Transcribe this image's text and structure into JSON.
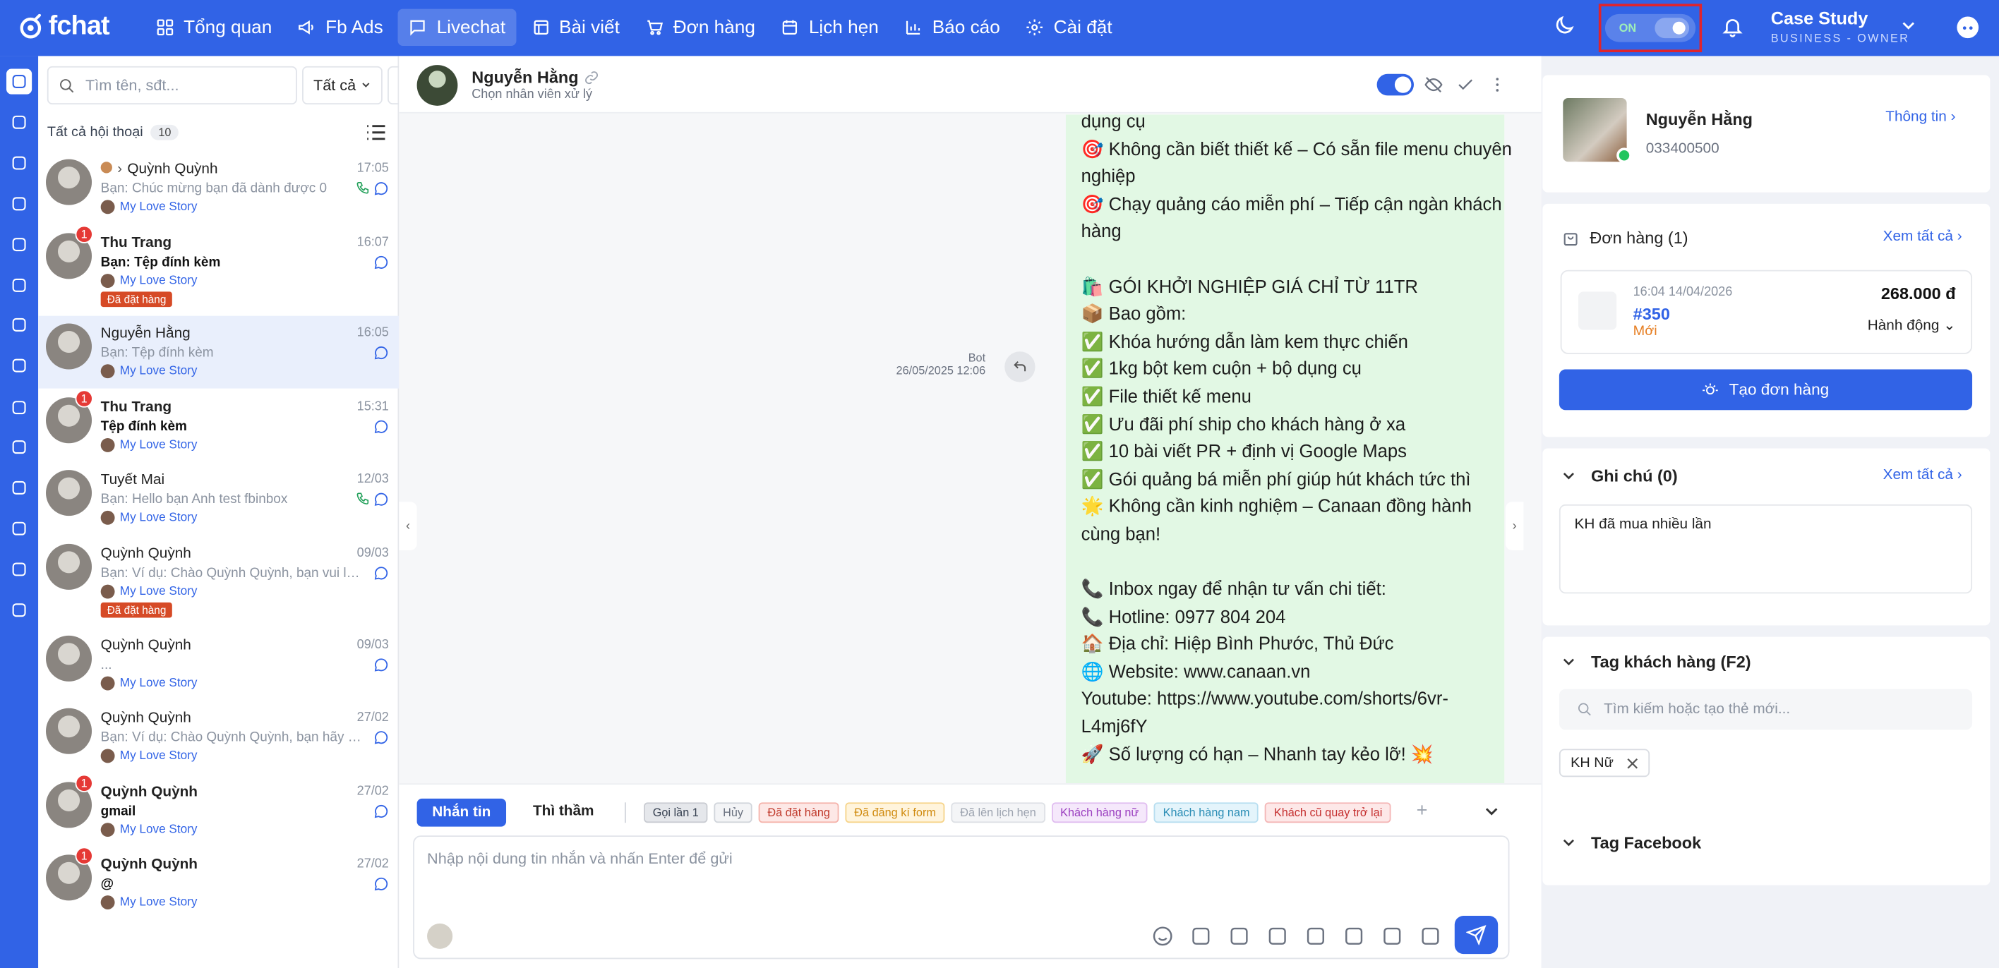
{
  "app": {
    "logo_text": "fchat"
  },
  "nav": [
    {
      "label": "Tổng quan",
      "icon": "grid-icon"
    },
    {
      "label": "Fb Ads",
      "icon": "megaphone-icon"
    },
    {
      "label": "Livechat",
      "icon": "chat-icon",
      "active": true
    },
    {
      "label": "Bài viết",
      "icon": "document-icon"
    },
    {
      "label": "Đơn hàng",
      "icon": "cart-icon"
    },
    {
      "label": "Lịch hẹn",
      "icon": "calendar-icon"
    },
    {
      "label": "Báo cáo",
      "icon": "bar-chart-icon"
    },
    {
      "label": "Cài đặt",
      "icon": "gear-icon"
    }
  ],
  "header": {
    "toggle_label": "ON",
    "toggle_on": true
  },
  "account": {
    "name": "Case Study",
    "role": "BUSINESS - OWNER"
  },
  "colors": {
    "primary": "#3163e6",
    "highlight_border": "#e0242c",
    "bubble": "#e2f8e4",
    "unread": "#e53935",
    "order_tag": "#d64a26"
  },
  "sidebar_icons": [
    "apps-icon",
    "chat-bubble-icon",
    "chats-icon",
    "phone-icon",
    "mail-icon",
    "percent-icon",
    "circle-icon",
    "ad-off-icon",
    "check-circle-icon",
    "users-icon",
    "calendar-icon",
    "robot-icon",
    "megaphone-icon",
    "file-text-icon"
  ],
  "conv_list": {
    "search_placeholder": "Tìm tên, sđt...",
    "filter": "Tất cả",
    "add": "+",
    "all_label": "Tất cả hội thoại",
    "all_count": "10",
    "items": [
      {
        "name": "Quỳnh Quỳnh",
        "msg": "Bạn: Chúc mừng bạn đã dành được 0",
        "page": "My Love Story",
        "time": "17:05",
        "unread": "",
        "tag": "",
        "bold": false,
        "phone": true,
        "prefix": true
      },
      {
        "name": "Thu Trang",
        "msg": "Bạn: Tệp đính kèm",
        "page": "My Love Story",
        "time": "16:07",
        "unread": "1",
        "tag": "Đã đặt hàng",
        "bold": true
      },
      {
        "name": "Nguyễn Hằng",
        "msg": "Bạn: Tệp đính kèm",
        "page": "My Love Story",
        "time": "16:05",
        "unread": "",
        "tag": "",
        "bold": false,
        "active": true
      },
      {
        "name": "Thu Trang",
        "msg": "Tệp đính kèm",
        "page": "My Love Story",
        "time": "15:31",
        "unread": "1",
        "tag": "",
        "bold": true
      },
      {
        "name": "Tuyết Mai",
        "msg": "Bạn: Hello bạn Anh test fbinbox",
        "page": "My Love Story",
        "time": "12/03",
        "unread": "",
        "tag": "",
        "bold": false,
        "phone": true
      },
      {
        "name": "Quỳnh Quỳnh",
        "msg": "Bạn: Ví dụ: Chào Quỳnh Quỳnh, bạn vui lòn...",
        "page": "My Love Story",
        "time": "09/03",
        "unread": "",
        "tag": "Đã đặt hàng",
        "bold": false
      },
      {
        "name": "Quỳnh Quỳnh",
        "msg": "...",
        "page": "My Love Story",
        "time": "09/03",
        "unread": "",
        "tag": "",
        "bold": false
      },
      {
        "name": "Quỳnh Quỳnh",
        "msg": "Bạn: Ví dụ: Chào Quỳnh Quỳnh, bạn hãy kiể...",
        "page": "My Love Story",
        "time": "27/02",
        "unread": "",
        "tag": "",
        "bold": false
      },
      {
        "name": "Quỳnh Quỳnh",
        "msg": "gmail",
        "page": "My Love Story",
        "time": "27/02",
        "unread": "1",
        "tag": "",
        "bold": true
      },
      {
        "name": "Quỳnh Quỳnh",
        "msg": "@",
        "page": "My Love Story",
        "time": "27/02",
        "unread": "1",
        "tag": "",
        "bold": true
      }
    ]
  },
  "chat": {
    "name": "Nguyễn Hằng",
    "sub": "Chọn nhân viên xử lý",
    "bot_label": "Bot",
    "bot_time": "26/05/2025 12:06",
    "lines": [
      "dụng cụ",
      "🎯 Không cần biết thiết kế – Có sẵn file menu chuyên",
      "nghiệp",
      "🎯 Chạy quảng cáo miễn phí – Tiếp cận ngàn khách",
      "hàng",
      "",
      "🛍️ GÓI KHỞI NGHIỆP GIÁ CHỈ TỪ 11TR",
      "📦 Bao gồm:",
      "✅ Khóa hướng dẫn làm kem thực chiến",
      "✅ 1kg bột kem cuộn + bộ dụng cụ",
      "✅ File thiết kế menu",
      "✅ Ưu đãi phí ship cho khách hàng ở xa",
      "✅ 10 bài viết PR + định vị Google Maps",
      "✅ Gói quảng bá miễn phí giúp hút khách tức thì",
      "🌟 Không cần kinh nghiệm – Canaan đồng hành",
      "cùng bạn!",
      "",
      "📞 Inbox ngay để nhận tư vấn chi tiết:",
      "📞 Hotline: 0977 804 204",
      "🏠 Địa chỉ: Hiệp Bình Phước, Thủ Đức",
      "🌐 Website: www.canaan.vn",
      "Youtube: https://www.youtube.com/shorts/6vr-",
      "L4mj6fY",
      "🚀 Số lượng có hạn – Nhanh tay kẻo lỡ! 💥",
      ""
    ],
    "tab_message": "Nhắn tin",
    "tab_whisper": "Thì thầm",
    "quick_tags": [
      {
        "label": "Gọi lần 1",
        "bg": "#e5e7eb",
        "fg": "#374151",
        "bd": "#c9ccd2"
      },
      {
        "label": "Hủy",
        "bg": "#f3f4f6",
        "fg": "#6b7280",
        "bd": "#d1d5db"
      },
      {
        "label": "Đã đặt hàng",
        "bg": "#fde8e6",
        "fg": "#c0392b",
        "bd": "#f5b3ab"
      },
      {
        "label": "Đã đăng kí form",
        "bg": "#fff4dc",
        "fg": "#d08b10",
        "bd": "#f6d48a"
      },
      {
        "label": "Đã lên lịch hẹn",
        "bg": "#f4f5f7",
        "fg": "#9ca3af",
        "bd": "#dde0e5"
      },
      {
        "label": "Khách hàng nữ",
        "bg": "#f5e8fb",
        "fg": "#9b3fc0",
        "bd": "#e0bdf0"
      },
      {
        "label": "Khách hàng nam",
        "bg": "#e4f4fb",
        "fg": "#2a8db5",
        "bd": "#b7def0"
      },
      {
        "label": "Khách cũ quay trở lại",
        "bg": "#fde8e8",
        "fg": "#c53030",
        "bd": "#f4b6b6"
      }
    ],
    "input_placeholder": "Nhập nội dung tin nhắn và nhấn Enter để gửi"
  },
  "customer": {
    "name": "Nguyễn Hằng",
    "phone": "033400500",
    "info_link": "Thông tin",
    "orders_title": "Đơn hàng (1)",
    "view_all": "Xem tất cả",
    "order": {
      "date": "16:04 14/04/2026",
      "id": "#350",
      "status": "Mới",
      "amount": "268.000 đ",
      "action": "Hành động"
    },
    "create_order": "Tạo đơn hàng",
    "notes_title": "Ghi chú (0)",
    "note": "KH đã mua nhiều lần",
    "tags_title": "Tag khách hàng (F2)",
    "tag_search_placeholder": "Tìm kiếm hoặc tạo thẻ mới...",
    "tag": "KH Nữ",
    "fb_tags_title": "Tag Facebook"
  }
}
